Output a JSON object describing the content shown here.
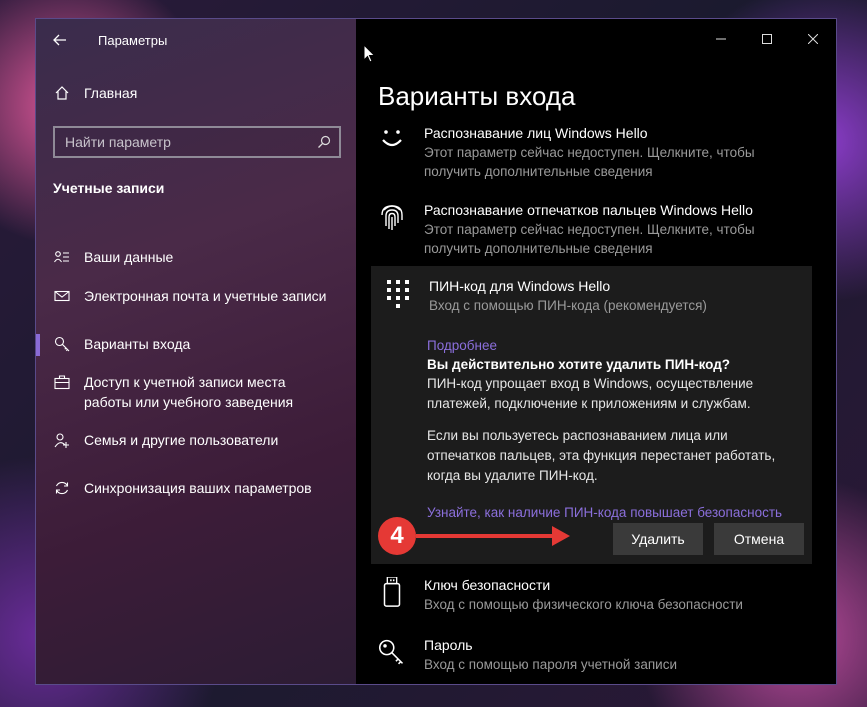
{
  "sidebar": {
    "window_title": "Параметры",
    "home_label": "Главная",
    "search_placeholder": "Найти параметр",
    "section_title": "Учетные записи",
    "items": [
      {
        "label": "Ваши данные",
        "icon": "person-card-icon"
      },
      {
        "label": "Электронная почта и учетные записи",
        "icon": "mail-icon"
      },
      {
        "label": "Варианты входа",
        "icon": "key-icon"
      },
      {
        "label": "Доступ к учетной записи места работы или учебного заведения",
        "icon": "briefcase-icon"
      },
      {
        "label": "Семья и другие пользователи",
        "icon": "person-add-icon"
      },
      {
        "label": "Синхронизация ваших параметров",
        "icon": "sync-icon"
      }
    ],
    "active_index": 2
  },
  "content": {
    "page_title": "Варианты входа",
    "options": [
      {
        "title": "Распознавание лиц Windows Hello",
        "desc": "Этот параметр сейчас недоступен. Щелкните, чтобы получить дополнительные сведения",
        "icon": "smile-face-icon"
      },
      {
        "title": "Распознавание отпечатков пальцев Windows Hello",
        "desc": "Этот параметр сейчас недоступен. Щелкните, чтобы получить дополнительные сведения",
        "icon": "fingerprint-icon"
      }
    ],
    "pin": {
      "title": "ПИН-код для Windows Hello",
      "desc": "Вход с помощью ПИН-кода (рекомендуется)",
      "more_link": "Подробнее",
      "question": "Вы действительно хотите удалить ПИН-код?",
      "para1": "ПИН-код упрощает вход в Windows, осуществление платежей, подключение к приложениям и службам.",
      "para2": "Если вы пользуетесь распознаванием лица или отпечатков пальцев, эта функция перестанет работать, когда вы удалите ПИН-код.",
      "learn_link": "Узнайте, как наличие ПИН-кода повышает безопасность",
      "delete_label": "Удалить",
      "cancel_label": "Отмена"
    },
    "security_key": {
      "title": "Ключ безопасности",
      "desc": "Вход с помощью физического ключа безопасности"
    },
    "password": {
      "title": "Пароль",
      "desc": "Вход с помощью пароля учетной записи"
    }
  },
  "annotation": {
    "step": "4",
    "color": "#e53935"
  },
  "colors": {
    "accent": "#8b6fdc",
    "panel_bg": "#1c1c1c",
    "button_bg": "#3a3a3a"
  }
}
